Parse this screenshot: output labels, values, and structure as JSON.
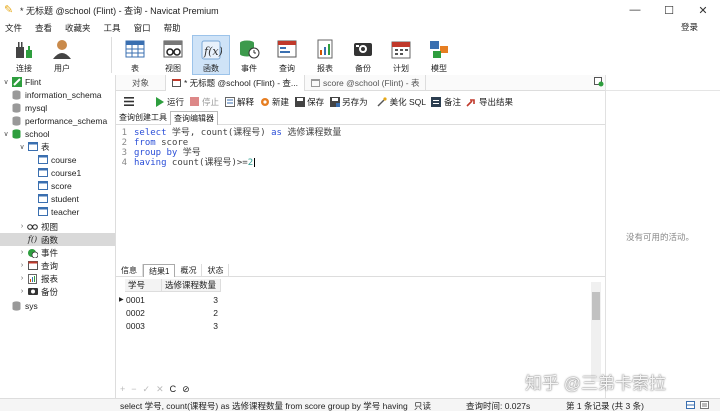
{
  "window": {
    "title": "* 无标题 @school (Flint) - 查询 - Navicat Premium",
    "minimize_glyph": "—",
    "maximize_glyph": "☐",
    "close_glyph": "✕"
  },
  "menu": {
    "items": [
      "文件",
      "查看",
      "收藏夹",
      "工具",
      "窗口",
      "帮助"
    ],
    "login": "登录"
  },
  "toolbar": {
    "items": [
      {
        "label": "连接",
        "icon": "plug-icon"
      },
      {
        "label": "用户",
        "icon": "user-icon"
      },
      {
        "label": "表",
        "icon": "table-icon"
      },
      {
        "label": "视图",
        "icon": "view-icon"
      },
      {
        "label": "函数",
        "icon": "function-icon"
      },
      {
        "label": "事件",
        "icon": "event-icon"
      },
      {
        "label": "查询",
        "icon": "query-icon"
      },
      {
        "label": "报表",
        "icon": "report-icon"
      },
      {
        "label": "备份",
        "icon": "backup-icon"
      },
      {
        "label": "计划",
        "icon": "schedule-icon"
      },
      {
        "label": "模型",
        "icon": "model-icon"
      }
    ],
    "active": "函数"
  },
  "tree": {
    "connection": "Flint",
    "databases": [
      "information_schema",
      "mysql",
      "performance_schema",
      "school",
      "sys"
    ],
    "school_nodes": {
      "tables_label": "表",
      "tables": [
        "course",
        "course1",
        "score",
        "student",
        "teacher"
      ],
      "views": "视图",
      "functions": "函数",
      "events": "事件",
      "queries": "查询",
      "reports": "报表",
      "backups": "备份"
    }
  },
  "tabs": [
    "对象",
    "* 无标题 @school (Flint) - 查...",
    "score @school (Flint) - 表"
  ],
  "editor_toolbar": {
    "run": "运行",
    "stop": "停止",
    "explain": "解释",
    "new": "新建",
    "save": "保存",
    "save_as": "另存为",
    "beautify": "美化 SQL",
    "note": "备注",
    "export": "导出结果"
  },
  "subtabs": [
    "查询创建工具",
    "查询编辑器"
  ],
  "code": {
    "line_numbers": [
      "1",
      "2",
      "3",
      "4"
    ],
    "l1": {
      "kw1": "select",
      "t1": " 学号, count(课程号) ",
      "kw2": "as",
      "t2": " 选修课程数量"
    },
    "l2": {
      "kw1": "from",
      "t1": " score"
    },
    "l3": {
      "kw1": "group by",
      "t1": " 学号"
    },
    "l4": {
      "kw1": "having",
      "t1": " count(课程号)>=",
      "num": "2"
    }
  },
  "result_tabs": [
    "信息",
    "结果1",
    "概况",
    "状态"
  ],
  "grid": {
    "columns": [
      "学号",
      "选修课程数量"
    ],
    "rows": [
      [
        "0001",
        "3"
      ],
      [
        "0002",
        "2"
      ],
      [
        "0003",
        "3"
      ]
    ]
  },
  "grid_nav": {
    "add": "+",
    "remove": "−",
    "apply": "✓",
    "cancel": "✕",
    "refresh": "C",
    "stop": "⊘"
  },
  "right_panel": {
    "no_activity": "没有可用的活动。"
  },
  "watermark": "知乎 @三弟卡索拉",
  "status": {
    "sql": "select 学号, count(课程号) as 选修课程数量 from score group by 学号 having",
    "readonly": "只读",
    "query_time": "查询时间: 0.027s",
    "records": "第 1 条记录 (共 3 条)"
  }
}
